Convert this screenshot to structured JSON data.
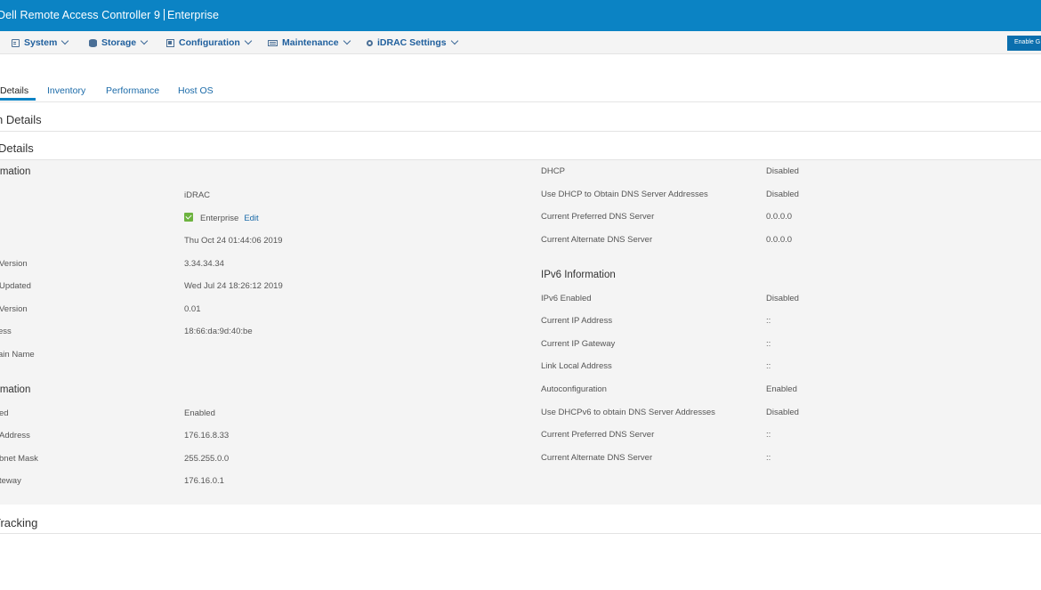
{
  "header": {
    "title": "Dell Remote Access Controller 9",
    "edition": "Enterprise"
  },
  "nav": {
    "items": [
      {
        "label": "System",
        "icon": "system-icon"
      },
      {
        "label": "Storage",
        "icon": "storage-icon"
      },
      {
        "label": "Configuration",
        "icon": "configuration-icon"
      },
      {
        "label": "Maintenance",
        "icon": "maintenance-icon"
      },
      {
        "label": "iDRAC Settings",
        "icon": "gear-icon"
      }
    ],
    "enable_button_label": "Enable G"
  },
  "tabs": [
    {
      "label": "Details",
      "active": true
    },
    {
      "label": "Inventory",
      "active": false
    },
    {
      "label": "Performance",
      "active": false
    },
    {
      "label": "Host OS",
      "active": false
    }
  ],
  "page": {
    "section_title": "n Details",
    "subsection_title": "Details",
    "tracking_title": "Tracking"
  },
  "left": {
    "info_title": "rmation",
    "rows": [
      {
        "label": "",
        "value": "iDRAC"
      },
      {
        "label": "",
        "value": "Enterprise",
        "link": "Edit"
      },
      {
        "label": "",
        "value": "Thu Oct 24 01:44:06 2019"
      },
      {
        "label": "Version",
        "value": "3.34.34.34"
      },
      {
        "label": "Updated",
        "value": "Wed Jul 24 18:26:12 2019"
      },
      {
        "label": "Version",
        "value": "0.01"
      },
      {
        "label": "ess",
        "value": "18:66:da:9d:40:be"
      },
      {
        "label": "ain Name",
        "value": ""
      }
    ],
    "ipv4_title": "rmation",
    "ipv4_rows": [
      {
        "label": "ed",
        "value": "Enabled"
      },
      {
        "label": "Address",
        "value": "176.16.8.33"
      },
      {
        "label": "bnet Mask",
        "value": "255.255.0.0"
      },
      {
        "label": "teway",
        "value": "176.16.0.1"
      }
    ]
  },
  "right": {
    "rows": [
      {
        "label": "DHCP",
        "value": "Disabled"
      },
      {
        "label": "Use DHCP to Obtain DNS Server Addresses",
        "value": "Disabled"
      },
      {
        "label": "Current Preferred DNS Server",
        "value": "0.0.0.0"
      },
      {
        "label": "Current Alternate DNS Server",
        "value": "0.0.0.0"
      }
    ],
    "ipv6_title": "IPv6 Information",
    "ipv6_rows": [
      {
        "label": "IPv6 Enabled",
        "value": "Disabled"
      },
      {
        "label": "Current IP Address",
        "value": "::"
      },
      {
        "label": "Current IP Gateway",
        "value": "::"
      },
      {
        "label": "Link Local Address",
        "value": "::"
      },
      {
        "label": "Autoconfiguration",
        "value": "Enabled"
      },
      {
        "label": "Use DHCPv6 to obtain DNS Server Addresses",
        "value": "Disabled"
      },
      {
        "label": "Current Preferred DNS Server",
        "value": "::"
      },
      {
        "label": "Current Alternate DNS Server",
        "value": "::"
      }
    ]
  },
  "colors": {
    "brand_blue": "#0b83c4",
    "link_blue": "#1a6aa8",
    "check_green": "#6db33f",
    "panel_bg": "#f4f4f4"
  }
}
